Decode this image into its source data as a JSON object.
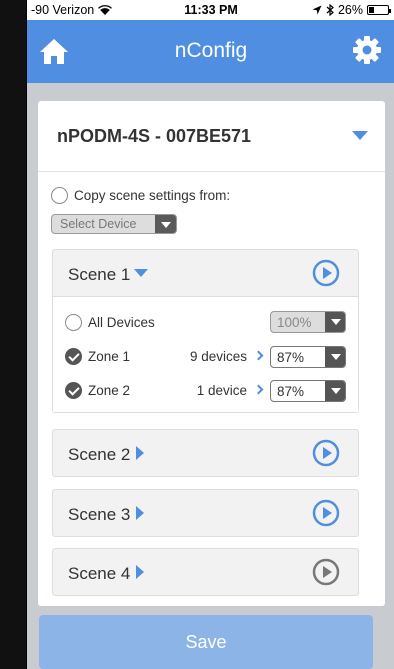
{
  "status_bar": {
    "carrier": "-90 Verizon",
    "time": "11:33 PM",
    "battery": "26%",
    "battery_level": 0.26
  },
  "nav": {
    "title": "nConfig"
  },
  "device": {
    "name": "nPODM-4S - 007BE571"
  },
  "copy": {
    "label": "Copy scene settings from:",
    "select_placeholder": "Select Device"
  },
  "scenes": [
    {
      "label": "Scene 1",
      "expanded": true,
      "all_devices": {
        "label": "All Devices",
        "level": "100%"
      },
      "zones": [
        {
          "label": "Zone 1",
          "count": "9 devices",
          "level": "87%"
        },
        {
          "label": "Zone 2",
          "count": "1 device",
          "level": "87%"
        }
      ]
    },
    {
      "label": "Scene 2",
      "expanded": false
    },
    {
      "label": "Scene 3",
      "expanded": false
    },
    {
      "label": "Scene 4",
      "expanded": false
    }
  ],
  "save_label": "Save",
  "colors": {
    "accent": "#4f8ee0",
    "save_disabled": "#8db4e6",
    "play_inactive": "#777777"
  }
}
